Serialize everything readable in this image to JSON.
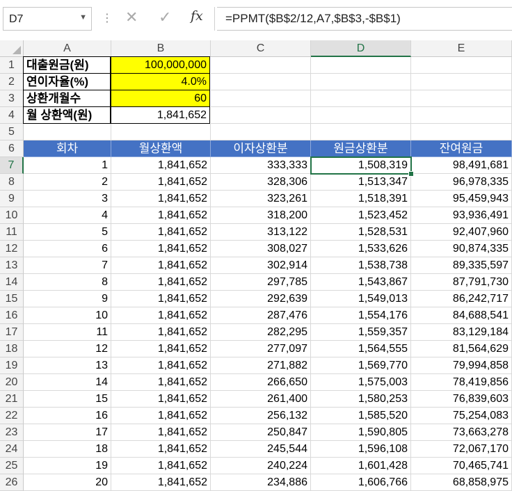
{
  "formula_bar": {
    "name_box": "D7",
    "name_box_icon": "chevron-down-icon",
    "separator": "⋮",
    "cancel_glyph": "✕",
    "enter_glyph": "✓",
    "fx_label": "fx",
    "formula": "=PPMT($B$2/12,A7,$B$3,-$B$1)"
  },
  "columns": [
    "A",
    "B",
    "C",
    "D",
    "E"
  ],
  "selected_column": "D",
  "selected_row": "7",
  "accent_color": "#217346",
  "header_fill": "#4472c4",
  "input_fill": "#ffff00",
  "params": [
    {
      "row": "1",
      "label": "대출원금(원)",
      "value": "100,000,000"
    },
    {
      "row": "2",
      "label": "연이자율(%)",
      "value": "4.0%"
    },
    {
      "row": "3",
      "label": "상환개월수",
      "value": "60"
    },
    {
      "row": "4",
      "label": "월 상환액(원)",
      "value": "1,841,652"
    }
  ],
  "row5": "5",
  "table_header": {
    "row": "6",
    "cols": [
      "회차",
      "월상환액",
      "이자상환분",
      "원금상환분",
      "잔여원금"
    ]
  },
  "rows": [
    {
      "row": "7",
      "cells": [
        "1",
        "1,841,652",
        "333,333",
        "1,508,319",
        "98,491,681"
      ]
    },
    {
      "row": "8",
      "cells": [
        "2",
        "1,841,652",
        "328,306",
        "1,513,347",
        "96,978,335"
      ]
    },
    {
      "row": "9",
      "cells": [
        "3",
        "1,841,652",
        "323,261",
        "1,518,391",
        "95,459,943"
      ]
    },
    {
      "row": "10",
      "cells": [
        "4",
        "1,841,652",
        "318,200",
        "1,523,452",
        "93,936,491"
      ]
    },
    {
      "row": "11",
      "cells": [
        "5",
        "1,841,652",
        "313,122",
        "1,528,531",
        "92,407,960"
      ]
    },
    {
      "row": "12",
      "cells": [
        "6",
        "1,841,652",
        "308,027",
        "1,533,626",
        "90,874,335"
      ]
    },
    {
      "row": "13",
      "cells": [
        "7",
        "1,841,652",
        "302,914",
        "1,538,738",
        "89,335,597"
      ]
    },
    {
      "row": "14",
      "cells": [
        "8",
        "1,841,652",
        "297,785",
        "1,543,867",
        "87,791,730"
      ]
    },
    {
      "row": "15",
      "cells": [
        "9",
        "1,841,652",
        "292,639",
        "1,549,013",
        "86,242,717"
      ]
    },
    {
      "row": "16",
      "cells": [
        "10",
        "1,841,652",
        "287,476",
        "1,554,176",
        "84,688,541"
      ]
    },
    {
      "row": "17",
      "cells": [
        "11",
        "1,841,652",
        "282,295",
        "1,559,357",
        "83,129,184"
      ]
    },
    {
      "row": "18",
      "cells": [
        "12",
        "1,841,652",
        "277,097",
        "1,564,555",
        "81,564,629"
      ]
    },
    {
      "row": "19",
      "cells": [
        "13",
        "1,841,652",
        "271,882",
        "1,569,770",
        "79,994,858"
      ]
    },
    {
      "row": "20",
      "cells": [
        "14",
        "1,841,652",
        "266,650",
        "1,575,003",
        "78,419,856"
      ]
    },
    {
      "row": "21",
      "cells": [
        "15",
        "1,841,652",
        "261,400",
        "1,580,253",
        "76,839,603"
      ]
    },
    {
      "row": "22",
      "cells": [
        "16",
        "1,841,652",
        "256,132",
        "1,585,520",
        "75,254,083"
      ]
    },
    {
      "row": "23",
      "cells": [
        "17",
        "1,841,652",
        "250,847",
        "1,590,805",
        "73,663,278"
      ]
    },
    {
      "row": "24",
      "cells": [
        "18",
        "1,841,652",
        "245,544",
        "1,596,108",
        "72,067,170"
      ]
    },
    {
      "row": "25",
      "cells": [
        "19",
        "1,841,652",
        "240,224",
        "1,601,428",
        "70,465,741"
      ]
    },
    {
      "row": "26",
      "cells": [
        "20",
        "1,841,652",
        "234,886",
        "1,606,766",
        "68,858,975"
      ]
    }
  ]
}
